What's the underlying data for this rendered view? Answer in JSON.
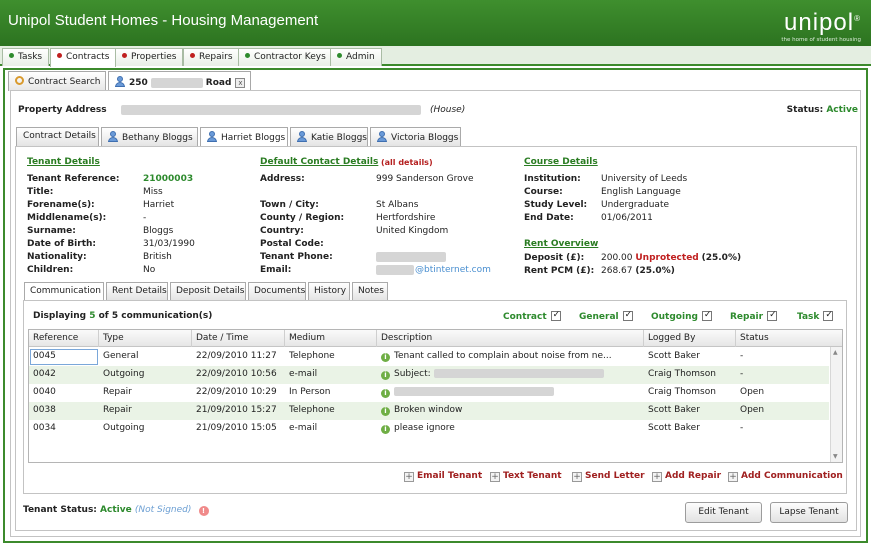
{
  "app": {
    "title": "Unipol Student Homes - Housing Management",
    "logo_word": "unipol",
    "logo_mark": "®",
    "logo_tagline": "the home of student housing"
  },
  "nav": [
    {
      "label": "Tasks",
      "color": "#2e8b2e"
    },
    {
      "label": "Contracts",
      "color": "#c02020"
    },
    {
      "label": "Properties",
      "color": "#c02020"
    },
    {
      "label": "Repairs",
      "color": "#c02020"
    },
    {
      "label": "Contractor Keys",
      "color": "#2e8b2e"
    },
    {
      "label": "Admin",
      "color": "#2e8b2e"
    }
  ],
  "content_tabs": {
    "search": "Contract Search",
    "contract_prefix": "250",
    "contract_suffix": "Road",
    "close": "x"
  },
  "property": {
    "label": "Property Address",
    "type": "(House)",
    "status_label": "Status:",
    "status_value": "Active"
  },
  "tenant_tabs": [
    "Contract Details",
    "Bethany Bloggs",
    "Harriet Bloggs",
    "Katie Bloggs",
    "Victoria Bloggs"
  ],
  "tenant": {
    "heading": "Tenant Details",
    "fields": [
      {
        "label": "Tenant Reference:",
        "value": "21000003"
      },
      {
        "label": "Title:",
        "value": "Miss"
      },
      {
        "label": "Forename(s):",
        "value": "Harriet"
      },
      {
        "label": "Middlename(s):",
        "value": "-"
      },
      {
        "label": "Surname:",
        "value": "Bloggs"
      },
      {
        "label": "Date of Birth:",
        "value": "31/03/1990"
      },
      {
        "label": "Nationality:",
        "value": "British"
      },
      {
        "label": "Children:",
        "value": "No"
      }
    ]
  },
  "contact": {
    "heading": "Default Contact Details",
    "all_details": "(all details)",
    "address_label": "Address:",
    "address": "999 Sanderson Grove",
    "fields": [
      {
        "label": "Town / City:",
        "value": "St Albans"
      },
      {
        "label": "County / Region:",
        "value": "Hertfordshire"
      },
      {
        "label": "Country:",
        "value": "United Kingdom"
      },
      {
        "label": "Postal Code:",
        "value": ""
      },
      {
        "label": "Tenant Phone:",
        "value": ""
      },
      {
        "label": "Email:",
        "value": "@btinternet.com"
      }
    ]
  },
  "course": {
    "heading": "Course Details",
    "fields": [
      {
        "label": "Institution:",
        "value": "University of Leeds"
      },
      {
        "label": "Course:",
        "value": "English Language"
      },
      {
        "label": "Study Level:",
        "value": "Undergraduate"
      },
      {
        "label": "End Date:",
        "value": "01/06/2011"
      }
    ]
  },
  "rent": {
    "heading": "Rent Overview",
    "deposit_label": "Deposit (£):",
    "deposit_value": "200.00",
    "deposit_status": "Unprotected",
    "deposit_pct": "(25.0%)",
    "pcm_label": "Rent PCM (£):",
    "pcm_value": "268.67",
    "pcm_pct": "(25.0%)"
  },
  "comm_tabs": [
    "Communication",
    "Rent Details",
    "Deposit Details",
    "Documents",
    "History",
    "Notes"
  ],
  "comms": {
    "display_prefix": "Displaying",
    "display_count": "5",
    "display_mid": "of",
    "display_total": "5",
    "display_suffix": "communication(s)",
    "filters": [
      "Contract",
      "General",
      "Outgoing",
      "Repair",
      "Task"
    ],
    "columns": [
      "Reference",
      "Type",
      "Date / Time",
      "Medium",
      "Description",
      "Logged By",
      "Status"
    ],
    "rows": [
      {
        "ref": "0045",
        "type": "General",
        "date": "22/09/2010 11:27",
        "medium": "Telephone",
        "desc": "Tenant called to complain about noise from ne...",
        "by": "Scott Baker",
        "status": "-"
      },
      {
        "ref": "0042",
        "type": "Outgoing",
        "date": "22/09/2010 10:56",
        "medium": "e-mail",
        "desc": "Subject:",
        "by": "Craig Thomson",
        "status": "-"
      },
      {
        "ref": "0040",
        "type": "Repair",
        "date": "22/09/2010 10:29",
        "medium": "In Person",
        "desc": "",
        "by": "Craig Thomson",
        "status": "Open"
      },
      {
        "ref": "0038",
        "type": "Repair",
        "date": "21/09/2010 15:27",
        "medium": "Telephone",
        "desc": "Broken window",
        "by": "Scott Baker",
        "status": "Open"
      },
      {
        "ref": "0034",
        "type": "Outgoing",
        "date": "21/09/2010 15:05",
        "medium": "e-mail",
        "desc": "please ignore",
        "by": "Scott Baker",
        "status": "-"
      }
    ],
    "actions": [
      "Email Tenant",
      "Text Tenant",
      "Send Letter",
      "Add Repair",
      "Add Communication"
    ]
  },
  "footer": {
    "status_label": "Tenant Status:",
    "status_value": "Active",
    "signed": "(Not Signed)",
    "warn": "!",
    "edit": "Edit Tenant",
    "lapse": "Lapse Tenant"
  }
}
